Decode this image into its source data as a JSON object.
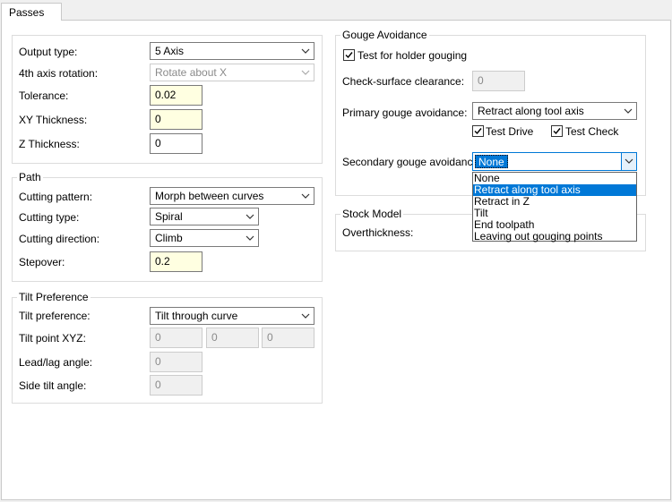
{
  "tab": {
    "label": "Passes"
  },
  "output_type": {
    "label": "Output type:",
    "value": "5 Axis"
  },
  "fourth_axis": {
    "label": "4th axis rotation:",
    "value": "Rotate  about X"
  },
  "tolerance": {
    "label": "Tolerance:",
    "value": "0.02"
  },
  "xy_thickness": {
    "label": "XY Thickness:",
    "value": "0"
  },
  "z_thickness": {
    "label": "Z Thickness:",
    "value": "0"
  },
  "path": {
    "title": "Path",
    "cutting_pattern": {
      "label": "Cutting pattern:",
      "value": "Morph between curves"
    },
    "cutting_type": {
      "label": "Cutting type:",
      "value": "Spiral"
    },
    "cutting_direction": {
      "label": "Cutting direction:",
      "value": "Climb"
    },
    "stepover": {
      "label": "Stepover:",
      "value": "0.2"
    }
  },
  "tilt": {
    "title": "Tilt Preference",
    "preference": {
      "label": "Tilt preference:",
      "value": "Tilt through curve"
    },
    "point": {
      "label": "Tilt point XYZ:",
      "x": "0",
      "y": "0",
      "z": "0"
    },
    "lead_lag": {
      "label": "Lead/lag angle:",
      "value": "0"
    },
    "side_tilt": {
      "label": "Side tilt angle:",
      "value": "0"
    }
  },
  "gouge": {
    "title": "Gouge Avoidance",
    "holder_check": {
      "label": "Test for holder gouging",
      "checked": true
    },
    "clearance": {
      "label": "Check-surface clearance:",
      "value": "0"
    },
    "primary": {
      "label": "Primary gouge avoidance:",
      "value": "Retract along tool axis"
    },
    "test_drive": {
      "label": "Test Drive",
      "checked": true
    },
    "test_check": {
      "label": "Test Check",
      "checked": true
    },
    "secondary": {
      "label": "Secondary gouge avoidance:",
      "value": "None",
      "options": [
        "None",
        "Retract along tool axis",
        "Retract in Z",
        "Tilt",
        "End toolpath",
        "Leaving out gouging points"
      ],
      "highlighted": "Retract along tool axis"
    }
  },
  "stock": {
    "title": "Stock Model",
    "overthickness": {
      "label": "Overthickness:"
    }
  },
  "colors": {
    "highlight": "#0078d7",
    "required_field": "#ffffe1"
  }
}
